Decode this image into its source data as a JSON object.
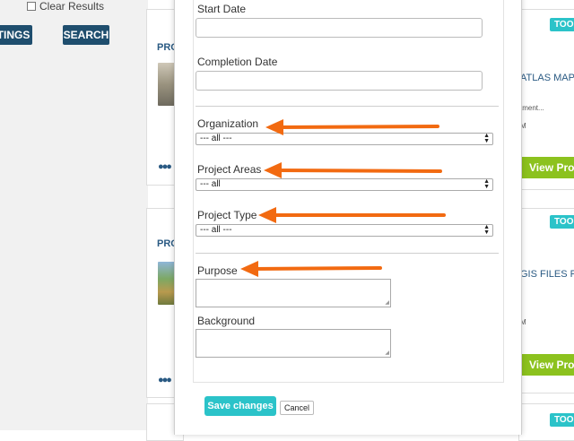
{
  "left_panel": {
    "clear_results_label": "Clear Results",
    "settings_button": "TINGS",
    "search_button": "SEARCH"
  },
  "cards_left": [
    {
      "title": "PRO"
    },
    {
      "title": "PRO"
    }
  ],
  "cards_right": [
    {
      "badge": "TOOI",
      "title": "ATLAS MAP",
      "snippet": "tment...",
      "meta": "M",
      "view_button": "View Proj"
    },
    {
      "badge": "TOOI",
      "title": "GIS FILES FO",
      "meta": "M",
      "view_button": "View Proj"
    },
    {
      "badge": "TOOI"
    }
  ],
  "form": {
    "start_date_label": "Start Date",
    "completion_date_label": "Completion Date",
    "organization_label": "Organization",
    "organization_value": "--- all ---",
    "project_areas_label": "Project Areas",
    "project_areas_value": "--- all",
    "project_type_label": "Project Type",
    "project_type_value": "--- all ---",
    "purpose_label": "Purpose",
    "background_label": "Background"
  },
  "footer": {
    "save_button": "Save changes",
    "cancel_button": "Cancel"
  },
  "colors": {
    "accent_teal": "#2bc3c9",
    "nav_dark": "#1f4e6e",
    "view_green": "#8cc21e",
    "annotation_arrow": "#f26a11"
  },
  "icons": {
    "people": "people-icon",
    "select_arrows": "select-arrows-icon"
  }
}
